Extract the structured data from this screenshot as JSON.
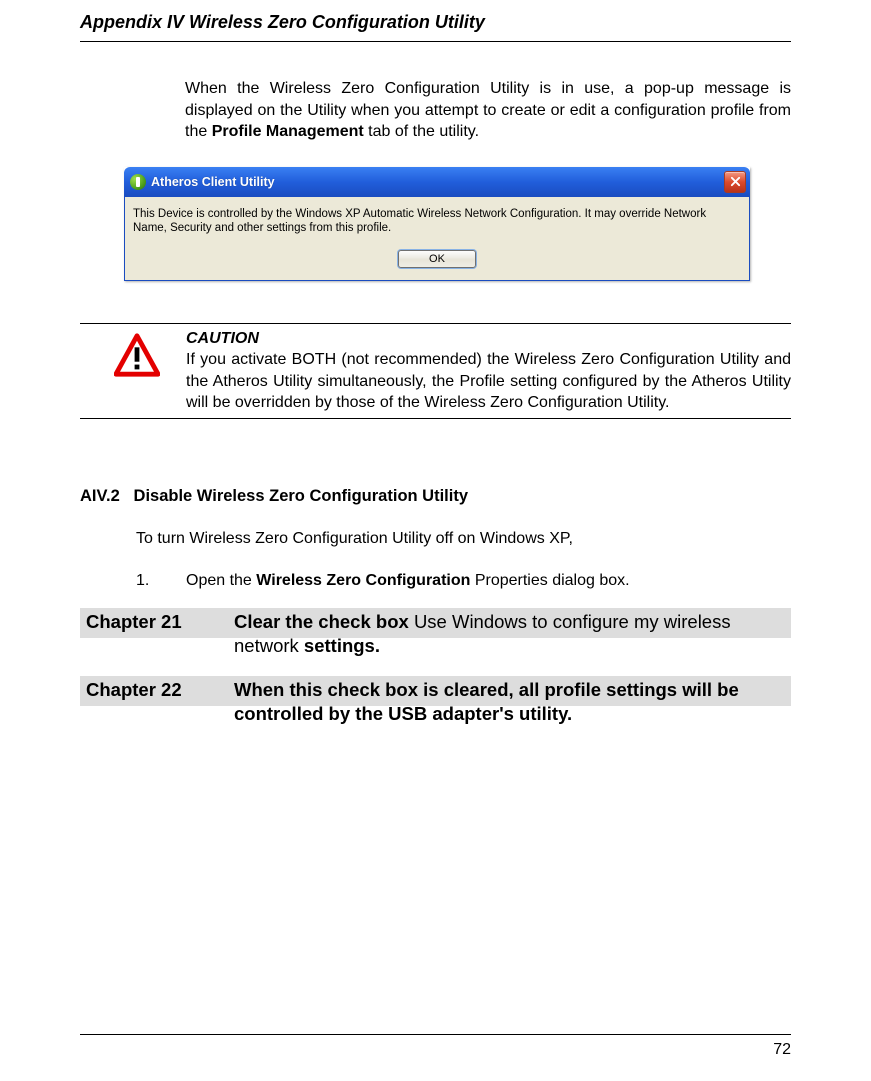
{
  "header": {
    "title": "Appendix IV  Wireless Zero Configuration Utility"
  },
  "intro": {
    "pre": "When the Wireless Zero Configuration Utility is in use, a pop-up message is displayed on the Utility when you attempt to create or edit a configuration profile from the ",
    "bold": "Profile Management",
    "post": " tab of the utility."
  },
  "dialog": {
    "title": "Atheros Client Utility",
    "message": "This Device is controlled by the Windows XP Automatic Wireless Network Configuration. It may override Network Name, Security and other settings from this profile.",
    "ok": "OK"
  },
  "caution": {
    "label": "CAUTION",
    "text": "If you activate BOTH (not recommended) the Wireless Zero Configuration Utility and the Atheros Utility simultaneously, the Profile setting configured by the Atheros Utility will be overridden by those of the Wireless Zero Configuration Utility."
  },
  "section": {
    "number": "AIV.2",
    "title": "Disable Wireless Zero Configuration Utility"
  },
  "subtext": "To turn Wireless Zero Configuration Utility off on Windows XP,",
  "step1": {
    "num": "1.",
    "pre": "Open the ",
    "bold": "Wireless Zero Configuration",
    "post": " Properties dialog box."
  },
  "chapter21": {
    "label": "Chapter 21",
    "b1": "Clear the check box ",
    "plain1": "Use Windows to configure my wireless network",
    "b2": " settings."
  },
  "chapter22": {
    "label": "Chapter 22",
    "text": "When this check box is cleared, all profile settings will be controlled by the USB adapter's utility."
  },
  "footer": {
    "page": "72"
  }
}
